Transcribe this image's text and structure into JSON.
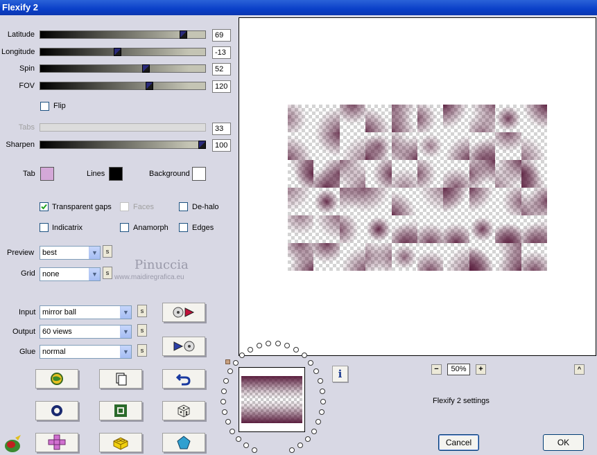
{
  "window": {
    "title": "Flexify 2"
  },
  "sliders": [
    {
      "label": "Latitude",
      "value": "69",
      "level": 0.86
    },
    {
      "label": "Longitude",
      "value": "-13",
      "level": 0.46
    },
    {
      "label": "Spin",
      "value": "52",
      "level": 0.64
    },
    {
      "label": "FOV",
      "value": "120",
      "level": 0.66
    },
    {
      "label": "Tabs",
      "value": "33",
      "level": null,
      "disabled": true
    },
    {
      "label": "Sharpen",
      "value": "100",
      "level": 0.97
    }
  ],
  "flip": {
    "label": "Flip",
    "checked": false
  },
  "colors": {
    "tab_label": "Tab",
    "tab_color": "#d4a8d8",
    "lines_label": "Lines",
    "lines_color": "#000000",
    "background_label": "Background",
    "background_color": "#ffffff"
  },
  "options": {
    "transparent_gaps": {
      "label": "Transparent gaps",
      "checked": true
    },
    "faces": {
      "label": "Faces",
      "checked": false,
      "disabled": true
    },
    "de_halo": {
      "label": "De-halo",
      "checked": false
    },
    "indicatrix": {
      "label": "Indicatrix",
      "checked": false
    },
    "anamorph": {
      "label": "Anamorph",
      "checked": false
    },
    "edges": {
      "label": "Edges",
      "checked": false
    }
  },
  "preview_sel": {
    "label": "Preview",
    "value": "best",
    "s": "s"
  },
  "grid_sel": {
    "label": "Grid",
    "value": "none",
    "s": "s"
  },
  "watermark": {
    "name": "Pinuccia",
    "site": "www.maidiregrafica.eu"
  },
  "input_sel": {
    "label": "Input",
    "value": "mirror ball",
    "s": "s"
  },
  "output_sel": {
    "label": "Output",
    "value": "60 views",
    "s": "s"
  },
  "glue_sel": {
    "label": "Glue",
    "value": "normal",
    "s": "s"
  },
  "zoom": {
    "minus": "−",
    "value": "50%",
    "plus": "+",
    "caret": "^"
  },
  "settings_text": "Flexify 2 settings",
  "info_icon": "i",
  "cancel_label": "Cancel",
  "ok_label": "OK",
  "accent": "#0a3fc8",
  "preview_tint": "#5a1e3e"
}
